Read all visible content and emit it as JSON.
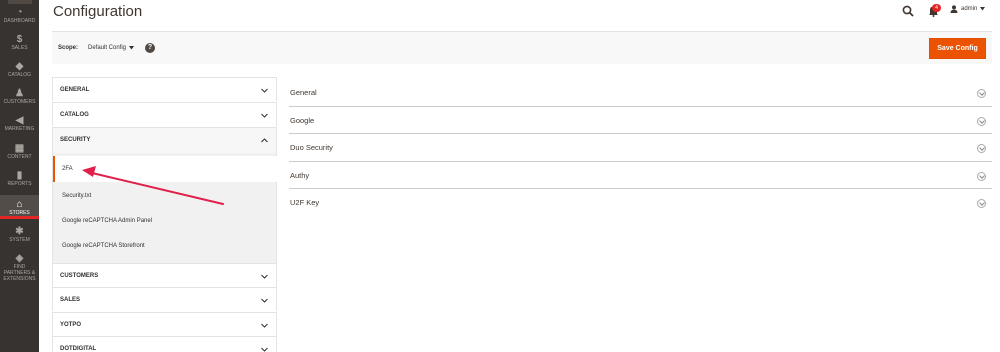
{
  "nav": {
    "items": [
      {
        "label": "DASHBOARD",
        "icon": "dashboard-icon",
        "glyph": "◔"
      },
      {
        "label": "SALES",
        "icon": "dollar-icon",
        "glyph": "$"
      },
      {
        "label": "CATALOG",
        "icon": "cube-icon",
        "glyph": "◆"
      },
      {
        "label": "CUSTOMERS",
        "icon": "person-icon",
        "glyph": "♟"
      },
      {
        "label": "MARKETING",
        "icon": "megaphone-icon",
        "glyph": "◀"
      },
      {
        "label": "CONTENT",
        "icon": "layout-icon",
        "glyph": "▦"
      },
      {
        "label": "REPORTS",
        "icon": "bar-chart-icon",
        "glyph": "▮"
      },
      {
        "label": "STORES",
        "icon": "store-icon",
        "glyph": "⌂"
      },
      {
        "label": "SYSTEM",
        "icon": "gear-icon",
        "glyph": "✱"
      },
      {
        "label": "FIND PARTNERS & EXTENSIONS",
        "icon": "box-icon",
        "glyph": "◈"
      }
    ]
  },
  "header": {
    "title": "Configuration",
    "notifications_count": "4",
    "user": "admin"
  },
  "scope": {
    "label": "Scope:",
    "value": "Default Config",
    "help": "?"
  },
  "toolbar": {
    "save_label": "Save Config"
  },
  "tabs": [
    {
      "title": "GENERAL",
      "state": "collapsed"
    },
    {
      "title": "CATALOG",
      "state": "collapsed"
    },
    {
      "title": "SECURITY",
      "state": "expanded"
    },
    {
      "title": "CUSTOMERS",
      "state": "collapsed"
    },
    {
      "title": "SALES",
      "state": "collapsed"
    },
    {
      "title": "YOTPO",
      "state": "collapsed"
    },
    {
      "title": "DOTDIGITAL",
      "state": "collapsed"
    }
  ],
  "security_items": [
    {
      "label": "2FA",
      "active": true
    },
    {
      "label": "Security.txt",
      "active": false
    },
    {
      "label": "Google reCAPTCHA Admin Panel",
      "active": false
    },
    {
      "label": "Google reCAPTCHA Storefront",
      "active": false
    }
  ],
  "sections": [
    {
      "title": "General"
    },
    {
      "title": "Google"
    },
    {
      "title": "Duo Security"
    },
    {
      "title": "Authy"
    },
    {
      "title": "U2F Key"
    }
  ],
  "colors": {
    "nav_bg": "#373330",
    "accent": "#eb5202",
    "annotation": "#e0204a"
  }
}
